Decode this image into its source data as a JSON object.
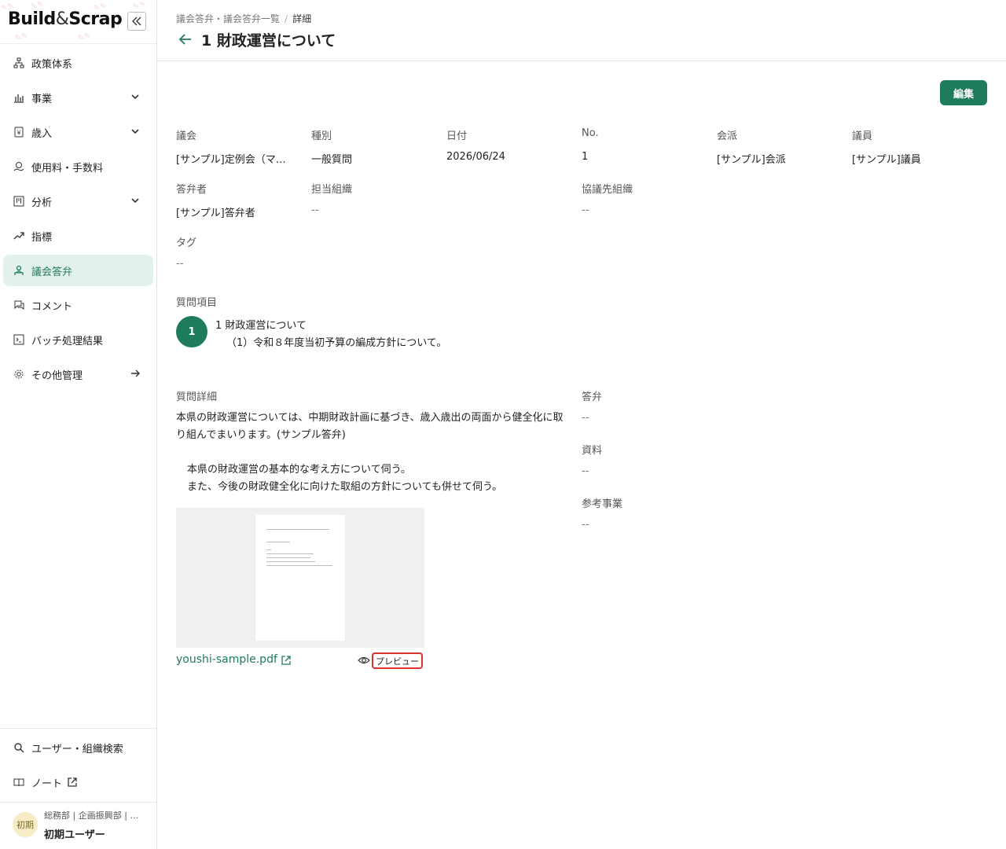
{
  "brand": {
    "logo_left": "Build",
    "logo_amp": "&",
    "logo_right": "Scrap"
  },
  "sidebar": {
    "items": [
      {
        "label": "政策体系"
      },
      {
        "label": "事業"
      },
      {
        "label": "歳入"
      },
      {
        "label": "使用料・手数料"
      },
      {
        "label": "分析"
      },
      {
        "label": "指標"
      },
      {
        "label": "議会答弁"
      },
      {
        "label": "コメント"
      },
      {
        "label": "バッチ処理結果"
      },
      {
        "label": "その他管理"
      }
    ],
    "bottom": [
      {
        "label": "ユーザー・組織検索"
      },
      {
        "label": "ノート"
      }
    ],
    "user": {
      "avatar": "初期",
      "org": "総務部 | 企画振興部 | …",
      "name": "初期ユーザー"
    }
  },
  "header": {
    "breadcrumb_parent": "議会答弁・議会答弁一覧",
    "breadcrumb_sep": "/",
    "breadcrumb_current": "詳細",
    "title": "1 財政運営について"
  },
  "actions": {
    "edit": "編集"
  },
  "fields": {
    "council_label": "議会",
    "council_value": "[サンプル]定例会（マ…",
    "type_label": "種別",
    "type_value": "一般質問",
    "date_label": "日付",
    "date_value": "2026/06/24",
    "no_label": "No.",
    "no_value": "1",
    "faction_label": "会派",
    "faction_value": "[サンプル]会派",
    "member_label": "議員",
    "member_value": "[サンプル]議員",
    "answerer_label": "答弁者",
    "answerer_value": "[サンプル]答弁者",
    "org_label": "担当組織",
    "org_value": "--",
    "coop_label": "協議先組織",
    "coop_value": "--",
    "tag_label": "タグ",
    "tag_value": "--"
  },
  "question_items": {
    "label": "質問項目",
    "number": "1",
    "line1": "1 財政運営について",
    "line2": "（1）令和８年度当初予算の編成方針について。"
  },
  "question_detail": {
    "label": "質問詳細",
    "para1": "本県の財政運営については、中期財政計画に基づき、歳入歳出の両面から健全化に取り組んでまいります。(サンプル答弁)",
    "line2": "本県の財政運営の基本的な考え方について伺う。",
    "line3": "また、今後の財政健全化に向けた取組の方針についても併せて伺う。"
  },
  "right_fields": {
    "answer_label": "答弁",
    "answer_value": "--",
    "material_label": "資料",
    "material_value": "--",
    "ref_label": "参考事業",
    "ref_value": "--"
  },
  "attachment": {
    "filename": "youshi-sample.pdf",
    "preview": "プレビュー"
  },
  "colors": {
    "accent": "#1e7c5a",
    "active_bg": "#e3f1eb",
    "highlight": "#d9332b"
  }
}
